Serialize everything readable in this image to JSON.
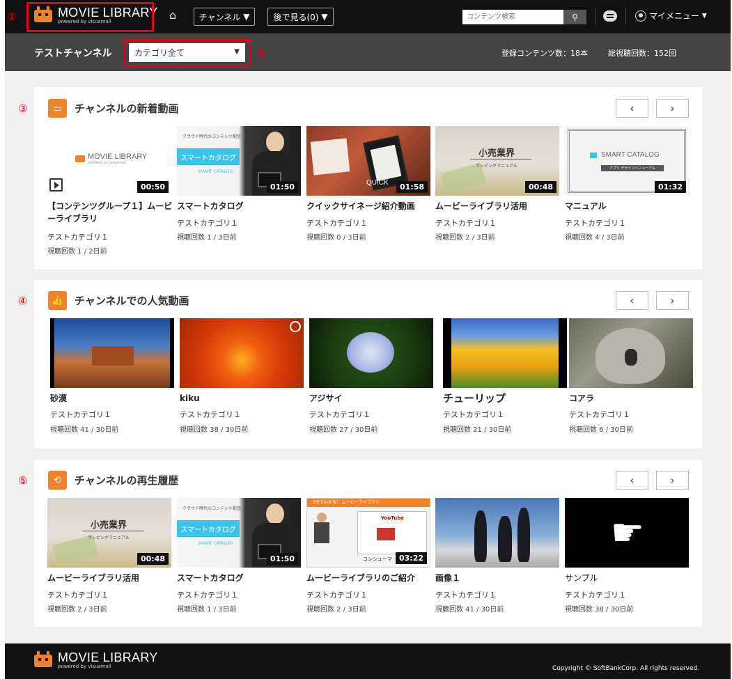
{
  "header": {
    "logo_title": "MOVIE LIBRARY",
    "logo_sub": "powered by visuamall",
    "channel_label": "チャンネル",
    "watch_later_label": "後で見る(0)",
    "search_placeholder": "コンテンツ検索",
    "my_menu_label": "マイメニュー"
  },
  "annotations": [
    "①",
    "②",
    "③",
    "④",
    "⑤"
  ],
  "channel_bar": {
    "name": "テストチャンネル",
    "category_select": "カテゴリ全て",
    "registered": "登録コンテンツ数：18本",
    "total_views": "総視聴回数：152回"
  },
  "sections": [
    {
      "title": "チャンネルの新着動画",
      "cards": [
        {
          "title": "【コンテンツグループ１】ムービーライブラリ",
          "category": "テストカテゴリ１",
          "views": "視聴回数 1 / 2日前",
          "duration": "00:50"
        },
        {
          "title": "スマートカタログ",
          "category": "テストカテゴリ１",
          "views": "視聴回数 1 / 3日前",
          "duration": "01:50"
        },
        {
          "title": "クイックサイネージ紹介動画",
          "category": "テストカテゴリ１",
          "views": "視聴回数 0 / 3日前",
          "duration": "01:58"
        },
        {
          "title": "ムービーライブラリ活用",
          "category": "テストカテゴリ１",
          "views": "視聴回数 2 / 3日前",
          "duration": "00:48"
        },
        {
          "title": "マニュアル",
          "category": "テストカテゴリ１",
          "views": "視聴回数 4 / 3日前",
          "duration": "01:32"
        }
      ]
    },
    {
      "title": "チャンネルでの人気動画",
      "cards": [
        {
          "title": "砂漠",
          "category": "テストカテゴリ１",
          "views": "視聴回数 41 / 30日前"
        },
        {
          "title": "kiku",
          "category": "テストカテゴリ１",
          "views": "視聴回数 38 / 30日前"
        },
        {
          "title": "アジサイ",
          "category": "テストカテゴリ１",
          "views": "視聴回数 27 / 30日前"
        },
        {
          "title": "チューリップ",
          "category": "テストカテゴリ１",
          "views": "視聴回数 21 / 30日前"
        },
        {
          "title": "コアラ",
          "category": "テストカテゴリ１",
          "views": "視聴回数 6 / 30日前"
        }
      ]
    },
    {
      "title": "チャンネルの再生履歴",
      "cards": [
        {
          "title": "ムービーライブラリ活用",
          "category": "テストカテゴリ１",
          "views": "視聴回数 2 / 3日前",
          "duration": "00:48"
        },
        {
          "title": "スマートカタログ",
          "category": "テストカテゴリ１",
          "views": "視聴回数 1 / 3日前",
          "duration": "01:50"
        },
        {
          "title": "ムービーライブラリのご紹介",
          "category": "テストカテゴリ１",
          "views": "視聴回数 2 / 3日前",
          "duration": "03:22"
        },
        {
          "title": "画像１",
          "category": "テストカテゴリ１",
          "views": "視聴回数 41 / 30日前"
        },
        {
          "title": "サンプル",
          "category": "テストカテゴリ１",
          "views": "視聴回数 38 / 30日前"
        }
      ]
    }
  ],
  "thumb_text": {
    "smart_catalog_banner": "スマートカタログ",
    "smart_catalog_top": "クラウド時代のコンテンツ配信",
    "smart_catalog_logo": "SMART CATALOG",
    "retail_title": "小売業界",
    "retail_sub": "ラッピングマニュアル",
    "manual_sub": "アプリ デザインリニューアル",
    "quick": "QUICK",
    "intro_top": "3分でわかる！ ムービーライブラリ",
    "youtube": "YouTube",
    "consumer": "コンシューマ"
  },
  "footer": {
    "copyright": "Copyright © SoftBankCorp. All rights reserved."
  }
}
